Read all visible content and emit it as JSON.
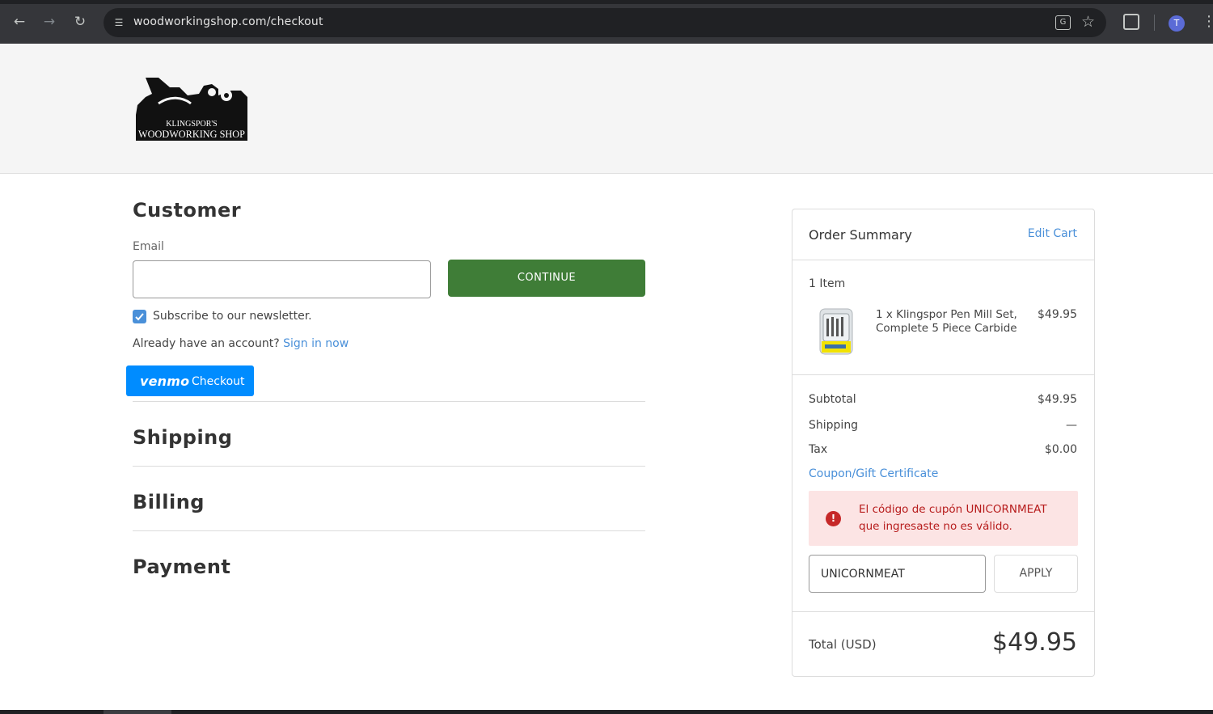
{
  "browser": {
    "url": "woodworkingshop.com/checkout",
    "back_icon": "arrow-left-icon",
    "forward_icon": "arrow-right-icon",
    "reload_icon": "reload-icon",
    "profile_initial": "T"
  },
  "header": {
    "logo_line1": "KLINGSPOR'S",
    "logo_line2": "WOODWORKING SHOP"
  },
  "customer": {
    "title": "Customer",
    "email_label": "Email",
    "email_value": "",
    "continue_label": "CONTINUE",
    "newsletter_label": "Subscribe to our newsletter.",
    "newsletter_checked": true,
    "account_prompt": "Already have an account?",
    "sign_in_label": "Sign in now",
    "venmo_logo": "venmo",
    "venmo_label": "Checkout"
  },
  "sections": {
    "shipping": "Shipping",
    "billing": "Billing",
    "payment": "Payment"
  },
  "summary": {
    "title": "Order Summary",
    "edit_cart": "Edit Cart",
    "item_count": "1 Item",
    "product_name": "1 x Klingspor Pen Mill Set, Complete 5 Piece Carbide",
    "product_price": "$49.95",
    "subtotal_label": "Subtotal",
    "subtotal_value": "$49.95",
    "shipping_label": "Shipping",
    "shipping_value": "—",
    "tax_label": "Tax",
    "tax_value": "$0.00",
    "coupon_link": "Coupon/Gift Certificate",
    "error_message": "El código de cupón UNICORNMEAT que ingresaste no es válido.",
    "coupon_value": "UNICORNMEAT",
    "apply_label": "APPLY",
    "total_label": "Total (USD)",
    "total_value": "$49.95"
  },
  "colors": {
    "accent_green": "#3f7d37",
    "link_blue": "#4a90d9",
    "venmo_blue": "#008cff",
    "error_red": "#b71c1c",
    "error_bg": "#fce4e4"
  }
}
